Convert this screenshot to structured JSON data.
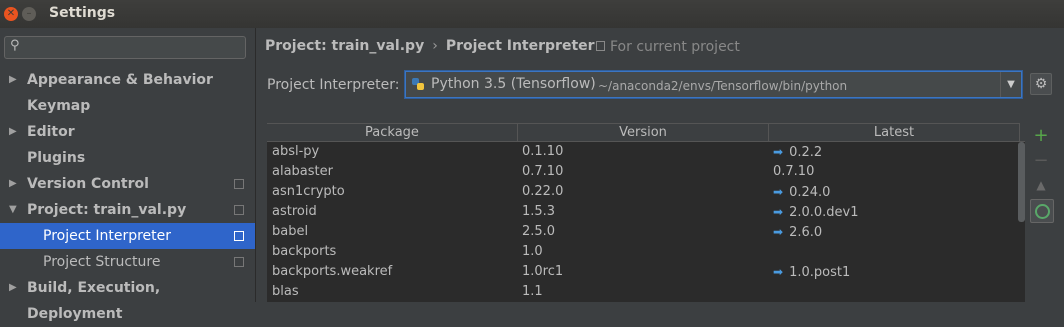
{
  "window": {
    "title": "Settings"
  },
  "sidebar": {
    "search_placeholder": "",
    "items": [
      {
        "label": "Appearance & Behavior",
        "arrow": "▶"
      },
      {
        "label": "Keymap",
        "arrow": ""
      },
      {
        "label": "Editor",
        "arrow": "▶"
      },
      {
        "label": "Plugins",
        "arrow": ""
      },
      {
        "label": "Version Control",
        "arrow": "▶"
      },
      {
        "label": "Project: train_val.py",
        "arrow": "▼"
      },
      {
        "label": "Project Interpreter",
        "arrow": ""
      },
      {
        "label": "Project Structure",
        "arrow": ""
      },
      {
        "label": "Build, Execution, Deployment",
        "arrow": "▶"
      }
    ]
  },
  "breadcrumb": {
    "project": "Project: train_val.py",
    "separator": "›",
    "page": "Project Interpreter",
    "note": "For current project"
  },
  "interpreter": {
    "label": "Project Interpreter:",
    "selected": "Python 3.5 (Tensorflow)",
    "path": "~/anaconda2/envs/Tensorflow/bin/python"
  },
  "table": {
    "headers": [
      "Package",
      "Version",
      "Latest"
    ],
    "rows": [
      {
        "package": "absl-py",
        "version": "0.1.10",
        "latest": "0.2.2",
        "upgrade": true
      },
      {
        "package": "alabaster",
        "version": "0.7.10",
        "latest": "0.7.10",
        "upgrade": false
      },
      {
        "package": "asn1crypto",
        "version": "0.22.0",
        "latest": "0.24.0",
        "upgrade": true
      },
      {
        "package": "astroid",
        "version": "1.5.3",
        "latest": "2.0.0.dev1",
        "upgrade": true
      },
      {
        "package": "babel",
        "version": "2.5.0",
        "latest": "2.6.0",
        "upgrade": true
      },
      {
        "package": "backports",
        "version": "1.0",
        "latest": "",
        "upgrade": false
      },
      {
        "package": "backports.weakref",
        "version": "1.0rc1",
        "latest": "1.0.post1",
        "upgrade": true
      },
      {
        "package": "blas",
        "version": "1.1",
        "latest": "",
        "upgrade": false
      }
    ]
  },
  "colors": {
    "accent": "#2f65ca",
    "upgrade_arrow": "#4a9be0",
    "add": "#57a64a"
  }
}
